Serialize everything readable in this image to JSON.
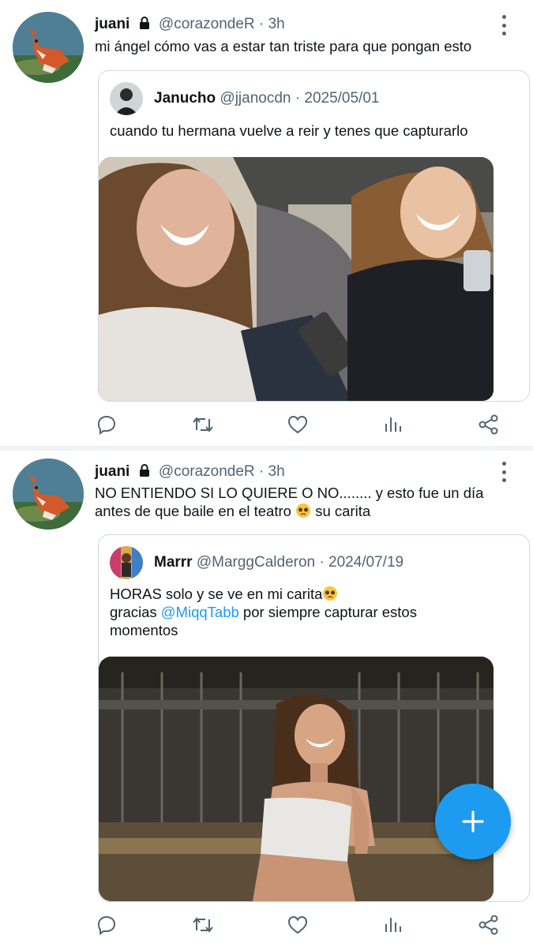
{
  "tweets": [
    {
      "author_name": "juani",
      "handle": "@corazondeR",
      "time": "3h",
      "text": "mi ángel cómo vas a estar tan triste para que pongan esto",
      "quote": {
        "author_name": "Janucho",
        "handle": "@jjanocdn",
        "date": "2025/05/01",
        "text": "cuando tu hermana vuelve a reir y tenes que capturarlo"
      }
    },
    {
      "author_name": "juani",
      "handle": "@corazondeR",
      "time": "3h",
      "text_line1": "NO ENTIENDO SI LO QUIERE O NO........ y esto fue un día",
      "text_line2_a": "antes de que baile en el teatro",
      "text_line2_b": "su carita",
      "quote": {
        "author_name": "Marrr",
        "handle": "@MarggCalderon",
        "date": "2024/07/19",
        "text_line1": "HORAS solo y se ve en mi carita",
        "text_line2_a": "gracias",
        "mention": "@MiqqTabb",
        "text_line2_b": "por siempre capturar estos",
        "text_line3": "momentos"
      }
    }
  ],
  "sep_dot": " · ",
  "icons": [
    "reply-icon",
    "retweet-icon",
    "like-icon",
    "views-icon",
    "share-icon",
    "compose-icon",
    "lock-icon",
    "more-icon"
  ],
  "colors": {
    "accent": "#1d9bf0",
    "secondary_text": "#536471",
    "border": "#cfd9de"
  }
}
